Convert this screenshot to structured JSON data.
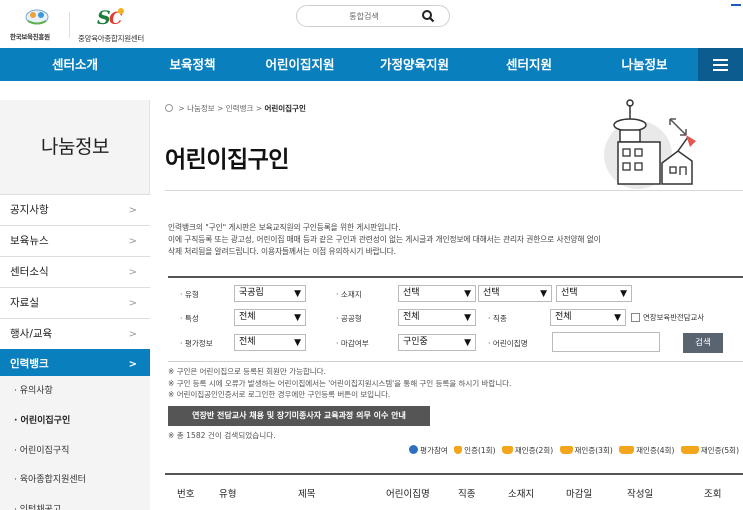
{
  "header": {
    "logo1_text": "한국보육진흥원",
    "logo2_text": "중앙육아종합지원센터",
    "search_placeholder": "통합검색"
  },
  "nav": {
    "items": [
      "센터소개",
      "보육정책",
      "어린이집지원",
      "가정양육지원",
      "센터지원",
      "나눔정보"
    ]
  },
  "sidebar": {
    "title": "나눔정보",
    "items": [
      {
        "label": "공지사항",
        "arrow": ">"
      },
      {
        "label": "보육뉴스",
        "arrow": ">"
      },
      {
        "label": "센터소식",
        "arrow": ">"
      },
      {
        "label": "자료실",
        "arrow": ">"
      },
      {
        "label": "행사/교육",
        "arrow": ">"
      },
      {
        "label": "인력뱅크",
        "arrow": ">"
      }
    ],
    "subitems": [
      "· 유의사항",
      "· 어린이집구인",
      "· 어린이집구직",
      "· 육아종합지원센터",
      "· 인턴채공고"
    ]
  },
  "breadcrumb": {
    "sep": ">",
    "items": [
      "나눔정보",
      "인력뱅크",
      "어린이집구인"
    ]
  },
  "page_title": "어린이집구인",
  "intro": [
    "인력뱅크의 \"구인\" 게시판은 보육교직원의 구인등록을 위한 게시판입니다.",
    "이에 구직등록 또는 광고성, 어린이집 매매 등과 같은 구인과 관련성이 없는 게시글과 개인정보에 대해서는 관리자 권한으로 사전양해 없이",
    "삭제 처리됨을 알려드립니다. 이용자들께서는 이점 유의하시기 바랍니다."
  ],
  "filters": {
    "type_label": "· 유형",
    "type_value": "국공립",
    "region_label": "· 소재지",
    "region_value1": "선택",
    "region_value2": "선택",
    "region_value3": "선택",
    "feature_label": "· 특성",
    "feature_value": "전체",
    "public_label": "· 공공형",
    "public_value": "전체",
    "job_label": "· 직종",
    "job_value": "전체",
    "extended_checkbox_label": "연장보육반전담교사",
    "eval_label": "· 평가정보",
    "eval_value": "전체",
    "deadline_label": "· 마감여부",
    "deadline_value": "구인중",
    "name_label": "· 어린이집명",
    "name_value": "",
    "search_button": "검색"
  },
  "notes": [
    "※ 구인은 어린이집으로 등록된 회원만 가능합니다.",
    "※ 구인 등록 시에 오류가 발생하는 어린이집에서는 '어린이집지원시스템'을 통해 구인 등록을 하시기 바랍니다.",
    "※ 어린이집공인인증서로 로그인한 경우에만 구인등록 버튼이 보입니다."
  ],
  "notice_button": "연장반 전담교사 채용 및 장기미종사자 교육과정 의무 이수 안내",
  "total_text": "※ 총 1582 건이 검색되었습니다.",
  "legend": [
    "평가참여",
    "인증(1회)",
    "재인증(2회)",
    "재인증(3회)",
    "재인증(4회)",
    "재인증(5회)"
  ],
  "table": {
    "columns": [
      "번호",
      "유형",
      "제목",
      "어린이집명",
      "직종",
      "소재지",
      "마감일",
      "작성일",
      "조회"
    ]
  },
  "colors": {
    "nav_bg": "#0a7fbd",
    "sidebar_active": "#0a7fbd",
    "search_button": "#5a6370"
  }
}
